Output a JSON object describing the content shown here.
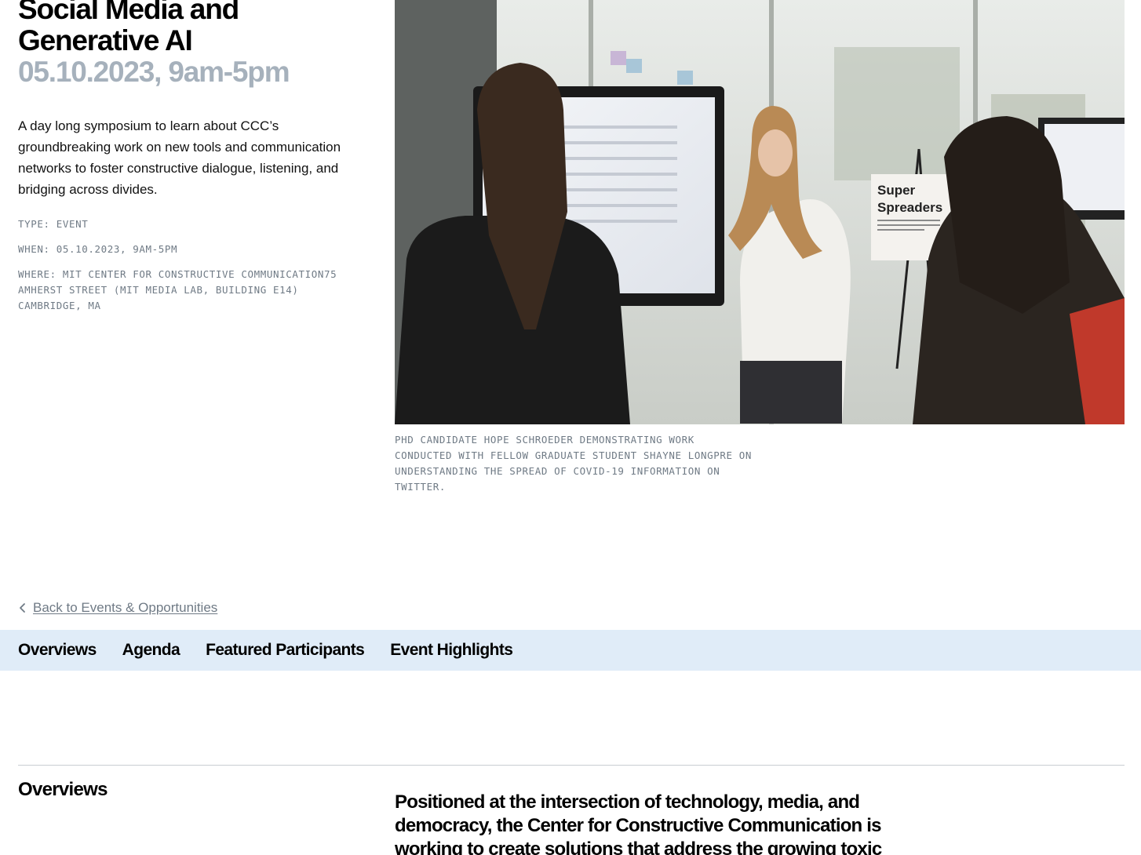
{
  "event": {
    "title": "Social Media and Generative AI",
    "date_display": "05.10.2023, 9am-5pm",
    "description": "A day long symposium to learn about CCC’s groundbreaking work on new tools and communication networks to foster constructive dialogue, listening, and bridging across divides.",
    "type_line": "TYPE: EVENT",
    "when_line": "WHEN: 05.10.2023, 9AM-5PM",
    "where_line": "WHERE: MIT CENTER FOR CONSTRUCTIVE COMMUNICATION75 AMHERST STREET (MIT MEDIA LAB, BUILDING E14) CAMBRIDGE, MA"
  },
  "photo": {
    "sign_text_line1": "Super",
    "sign_text_line2": "Spreaders",
    "caption": "PHD CANDIDATE HOPE SCHROEDER DEMONSTRATING WORK CONDUCTED WITH FELLOW GRADUATE STUDENT SHAYNE LONGPRE ON UNDERSTANDING THE SPREAD OF COVID-19 INFORMATION ON TWITTER."
  },
  "navigation": {
    "back_label": "Back to Events & Opportunities",
    "tabs": [
      {
        "label": "Overviews"
      },
      {
        "label": "Agenda"
      },
      {
        "label": "Featured Participants"
      },
      {
        "label": "Event Highlights"
      }
    ]
  },
  "overview": {
    "heading": "Overviews",
    "lead": "Positioned at the intersection of technology, media, and democracy, the Center for Constructive Communication is working to create solutions that address the growing toxic"
  },
  "colors": {
    "date": "#a6b1bc",
    "meta": "#6f7a85",
    "tab_bar": "#e0ecf8",
    "divider": "#c9cdd2"
  },
  "icons": {
    "back": "chevron-left-icon"
  }
}
